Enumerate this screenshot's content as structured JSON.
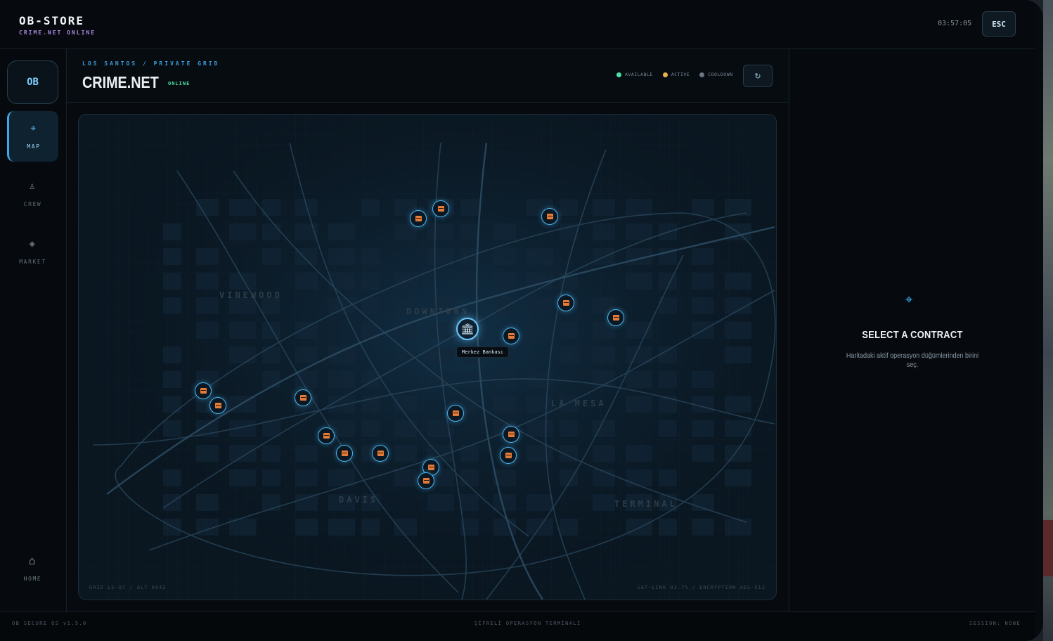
{
  "brand": {
    "name": "OB-STORE",
    "subtitle": "CRIME.NET ONLINE"
  },
  "topbar": {
    "clock": "03:57:05",
    "esc_label": "ESC"
  },
  "sidebar": {
    "logo": "OB",
    "items": [
      {
        "label": "MAP",
        "icon": "crosshair-icon",
        "active": true
      },
      {
        "label": "CREW",
        "icon": "chess-pawn-icon",
        "active": false
      },
      {
        "label": "MARKET",
        "icon": "diamond-icon",
        "active": false
      }
    ],
    "home_label": "HOME"
  },
  "header": {
    "breadcrumb": "LOS SANTOS / PRIVATE GRID",
    "title": "CRIME.NET",
    "status": "ONLINE",
    "legend": [
      {
        "label": "AVAILABLE",
        "color": "#4ae3a2"
      },
      {
        "label": "ACTIVE",
        "color": "#e8b24a"
      },
      {
        "label": "COOLDOWN",
        "color": "#6b7680"
      }
    ],
    "refresh_icon": "refresh-icon"
  },
  "map": {
    "districts": [
      "VINEWOOD",
      "DOWNTOWN",
      "LA MESA",
      "DAVIS",
      "TERMINAL"
    ],
    "bank_label": "Merkez Bankası",
    "footer_left": "GRID LS-07 / ALT 0042",
    "footer_right": "SAT-LINK 93.7% / ENCRYPTION AES-512"
  },
  "panel": {
    "title": "SELECT A CONTRACT",
    "description": "Haritadaki aktif operasyon düğümlerinden birini seç."
  },
  "footer": {
    "left": "OB SECURE OS v1.5.0",
    "center": "ŞİFRELİ OPERASYON TERMİNALİ",
    "right": "SESSION: NONE"
  },
  "colors": {
    "accent": "#3aa9e8",
    "marker": "#e57b38",
    "online": "#4ae3a2"
  }
}
